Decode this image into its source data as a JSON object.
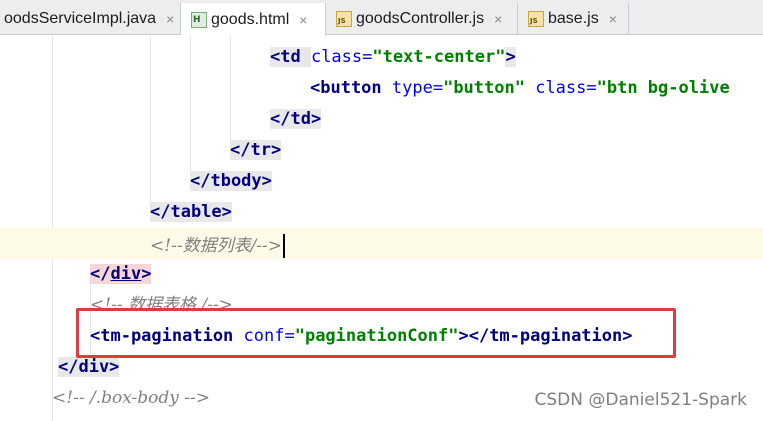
{
  "tabs": [
    {
      "label": "oodsServiceImpl.java",
      "icon": "none",
      "close": "×"
    },
    {
      "label": "goods.html",
      "icon": "html-file-icon",
      "icon_text": "H",
      "close": "×"
    },
    {
      "label": "goodsController.js",
      "icon": "js-file-icon",
      "icon_text": "JS",
      "close": "×"
    },
    {
      "label": "base.js",
      "icon": "js-file-icon",
      "icon_text": "JS",
      "close": "×"
    }
  ],
  "code": {
    "l1": {
      "open": "<td ",
      "attr": "class=",
      "value": "\"text-center\"",
      "close": ">"
    },
    "l2": {
      "open": "<button ",
      "attr1": "type=",
      "value1": "\"button\"",
      "attr2": " class=",
      "value2": "\"btn bg-olive"
    },
    "l3": {
      "text": "</td>"
    },
    "l4": {
      "text": "</tr>"
    },
    "l5": {
      "text": "</tbody>"
    },
    "l6": {
      "text": "</table>"
    },
    "l7": {
      "comment": "<!--数据列表/-->"
    },
    "l8": {
      "lt": "</",
      "name": "div",
      "gt": ">"
    },
    "l9": {
      "comment": "<!-- 数据表格 /-->"
    },
    "l10": {
      "open": "<tm-pagination ",
      "attr": "conf=",
      "value": "\"paginationConf\"",
      "close": "></tm-pagination>"
    },
    "l11": {
      "text": "</div>"
    },
    "l12": {
      "comment": "<!-- /.box-body -->"
    }
  },
  "watermark": "CSDN @Daniel521-Spark",
  "colors": {
    "tag": "#000080",
    "attribute": "#0000ff",
    "string": "#008000",
    "comment": "#808080",
    "highlight_box": "#e03a3a"
  }
}
